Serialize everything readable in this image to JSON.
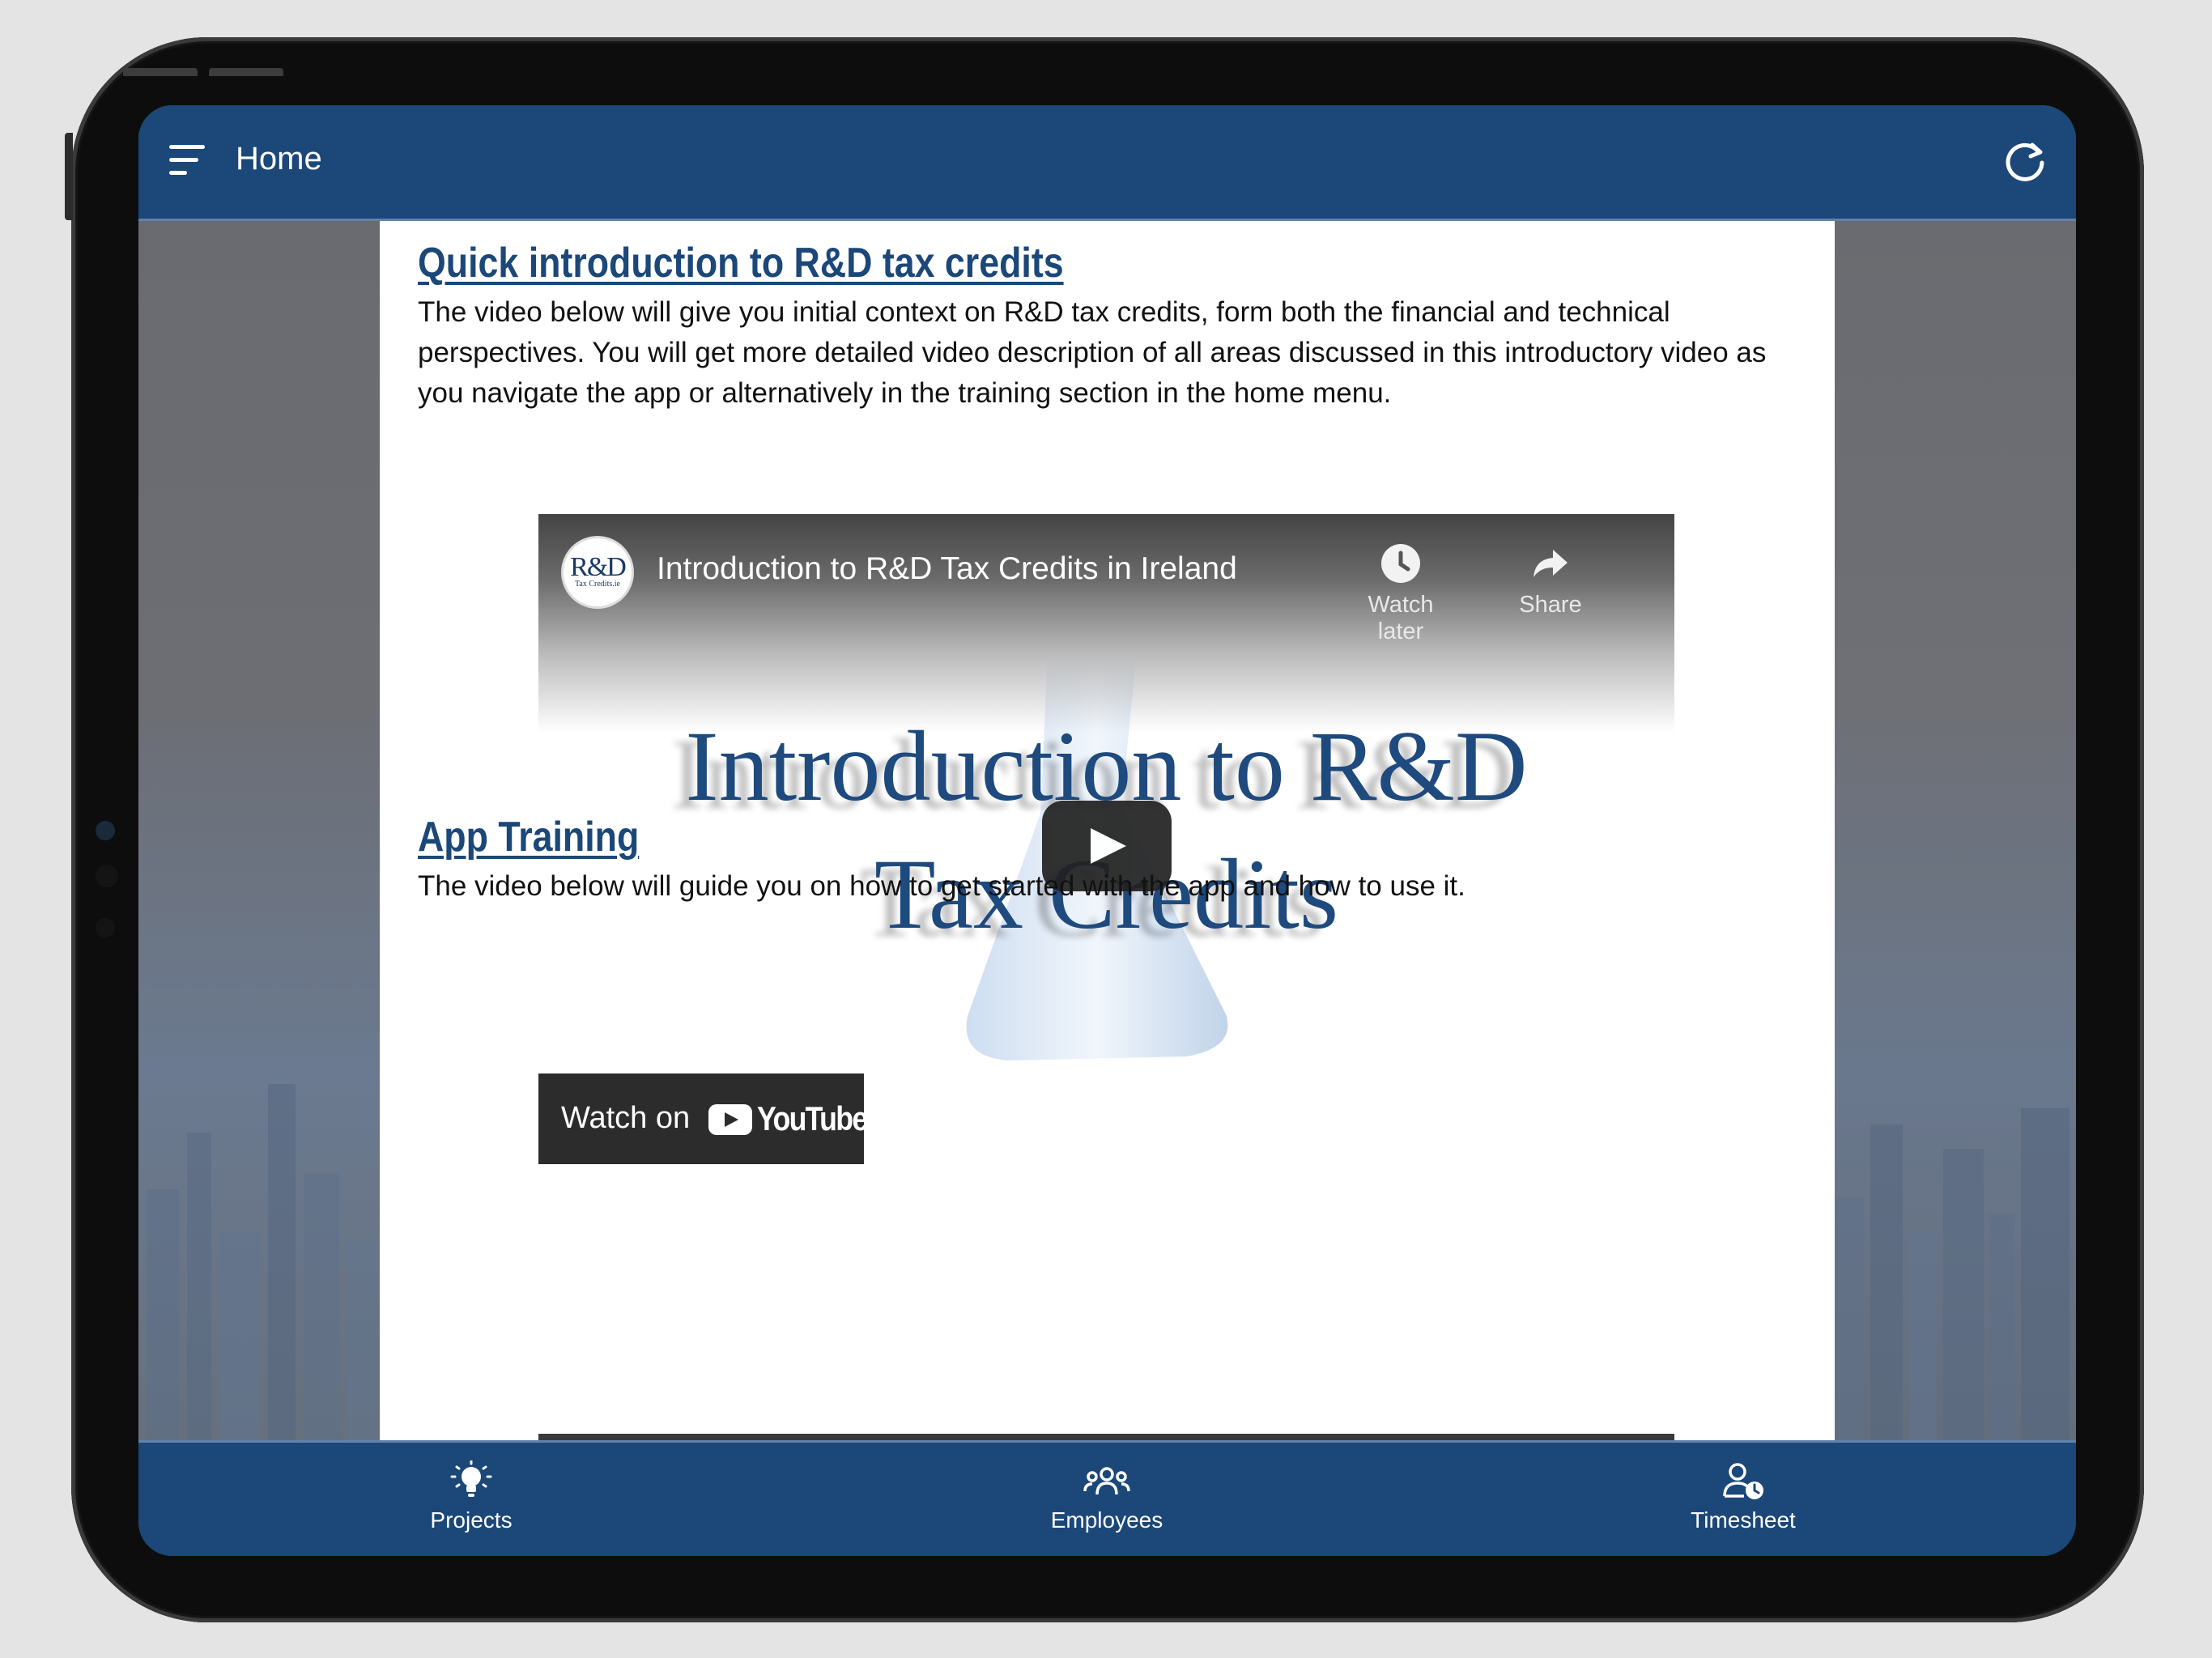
{
  "appbar": {
    "title": "Home"
  },
  "section_intro": {
    "heading": "Quick introduction to R&D tax credits",
    "description": "The video below will give you initial context on R&D tax credits, form both the financial and technical perspectives. You will get more detailed video description of all areas discussed in this introductory video as you navigate the app or alternatively in the training section in the home menu."
  },
  "video": {
    "channel_logo_line1": "R&D",
    "channel_logo_line2": "Tax Credits.ie",
    "title": "Introduction to R&D Tax Credits in Ireland",
    "watch_later_label": "Watch later",
    "share_label": "Share",
    "thumbnail_line1": "Introduction to R&D",
    "thumbnail_line2": "Tax Credits",
    "watch_on_label": "Watch on",
    "youtube_wordmark": "YouTube"
  },
  "section_training": {
    "heading": "App Training",
    "description": "The video below will guide you on how to get started with the app and how to use it."
  },
  "bottom_nav": {
    "items": [
      {
        "label": "Projects",
        "icon": "lightbulb-icon"
      },
      {
        "label": "Employees",
        "icon": "people-group-icon"
      },
      {
        "label": "Timesheet",
        "icon": "user-clock-icon"
      }
    ]
  },
  "colors": {
    "primary": "#1b4779",
    "heading": "#1b4779",
    "text": "#111111",
    "video_button_bg": "#212121"
  }
}
